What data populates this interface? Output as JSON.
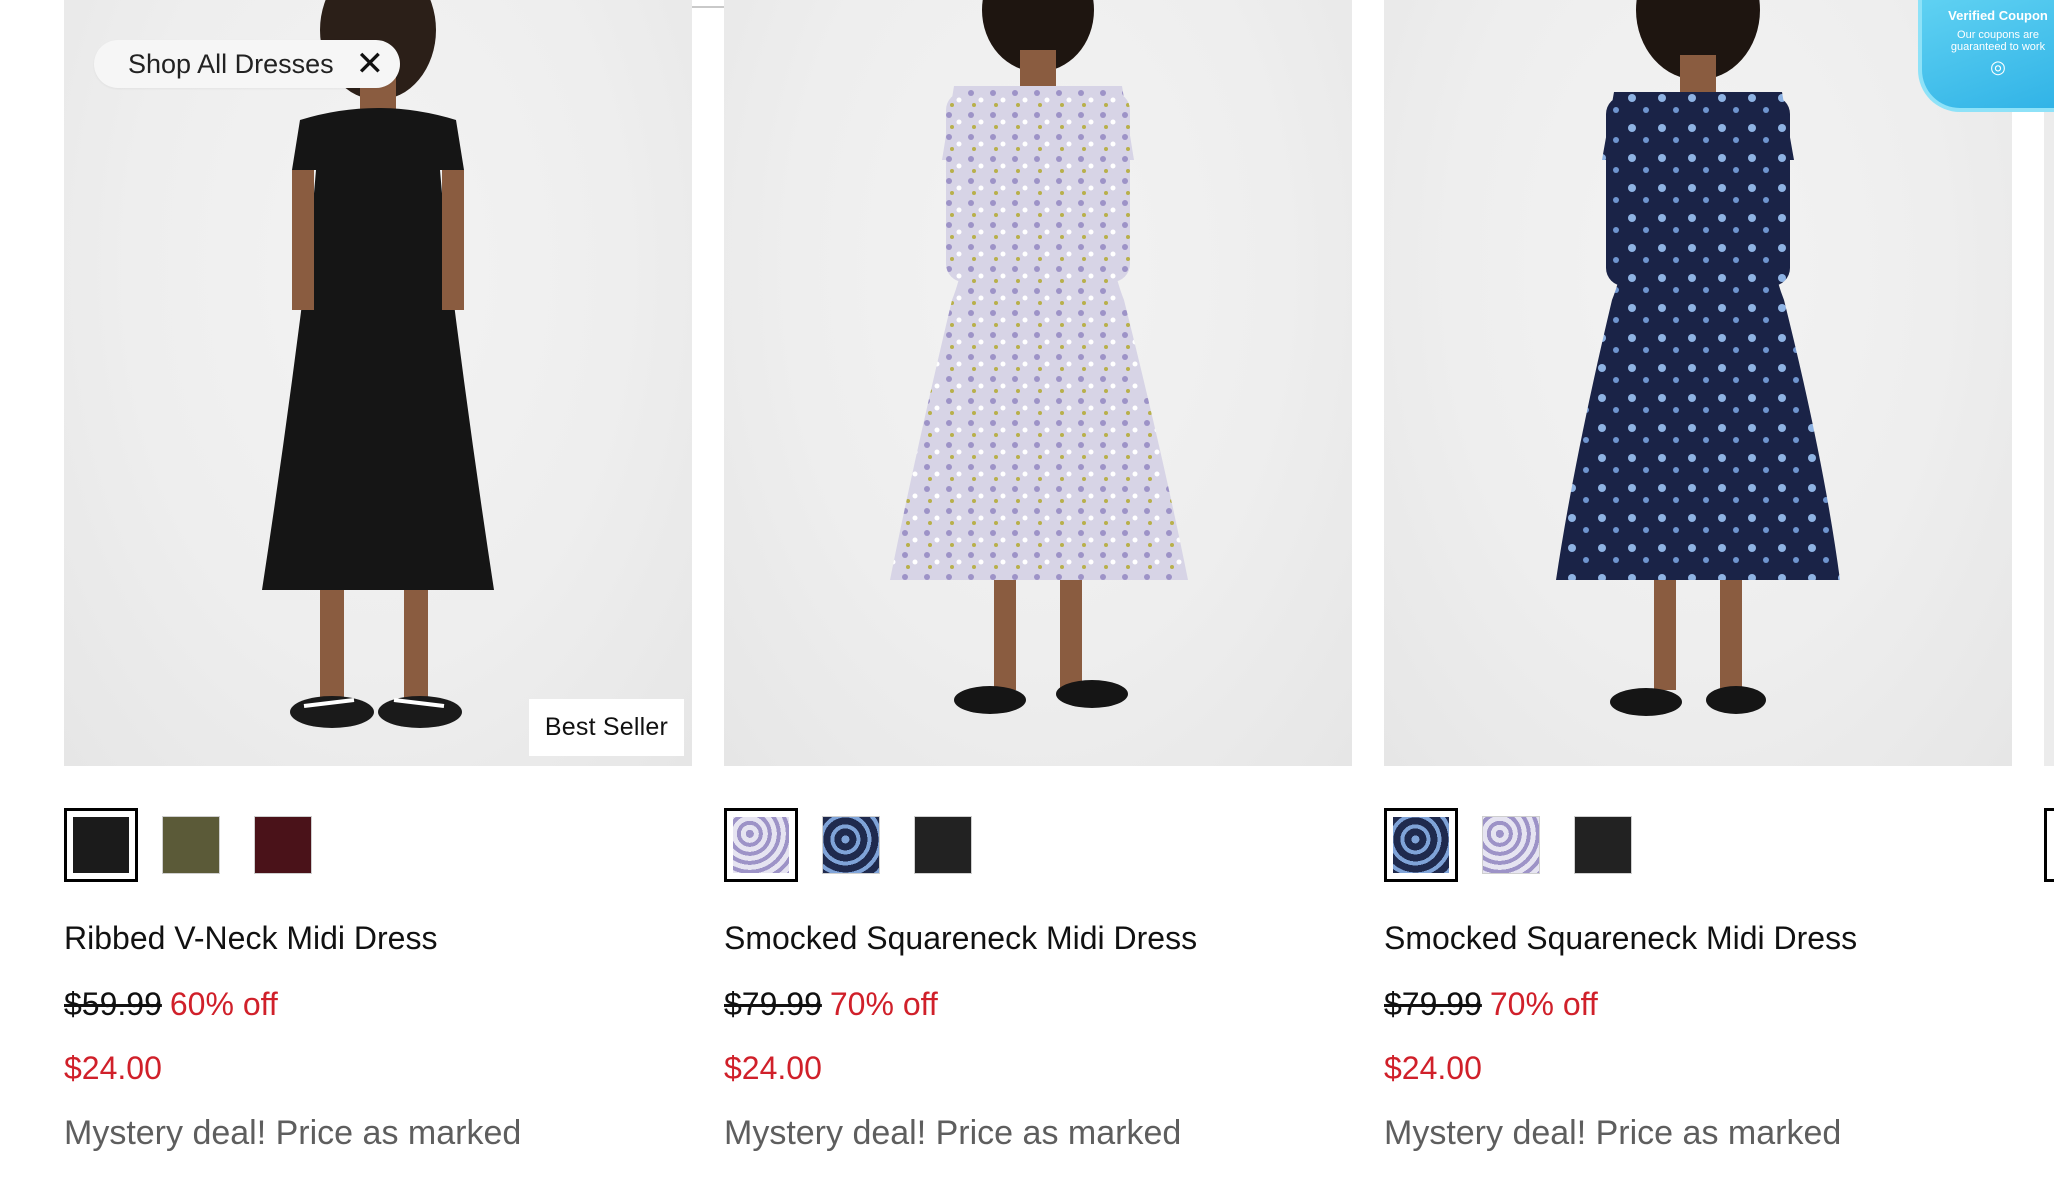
{
  "filters": {
    "chip_label": "Shop All Dresses"
  },
  "products": [
    {
      "title": "Ribbed V-Neck Midi Dress",
      "original_price": "$59.99",
      "discount": "60% off",
      "sale_price": "$24.00",
      "promo": "Mystery deal! Price as marked",
      "badge": "Best Seller",
      "swatches": [
        {
          "name": "black",
          "color": "#1b1b1b"
        },
        {
          "name": "olive",
          "color": "#5b5a38"
        },
        {
          "name": "burgundy",
          "color": "#4a1219"
        }
      ],
      "selected_swatch": 0,
      "dress_color": "#151515"
    },
    {
      "title": "Smocked Squareneck Midi Dress",
      "original_price": "$79.99",
      "discount": "70% off",
      "sale_price": "$24.00",
      "promo": "Mystery deal! Price as marked",
      "swatches": [
        {
          "name": "lavender-floral",
          "color": "#c7c3dc"
        },
        {
          "name": "navy-floral",
          "color": "#1f2a4e"
        },
        {
          "name": "black",
          "color": "#222222"
        }
      ],
      "selected_swatch": 0,
      "dress_color": "#c9c6da"
    },
    {
      "title": "Smocked Squareneck Midi Dress",
      "original_price": "$79.99",
      "discount": "70% off",
      "sale_price": "$24.00",
      "promo": "Mystery deal! Price as marked",
      "swatches": [
        {
          "name": "navy-floral",
          "color": "#1f2a4e"
        },
        {
          "name": "lavender-floral",
          "color": "#c7c3dc"
        },
        {
          "name": "black",
          "color": "#222222"
        }
      ],
      "selected_swatch": 0,
      "dress_color": "#1a2347"
    }
  ],
  "coupon": {
    "title": "Verified Coupon",
    "subtitle": "Our coupons are guaranteed to work",
    "icon": "coupon-icon",
    "color": "#3bbde9"
  }
}
